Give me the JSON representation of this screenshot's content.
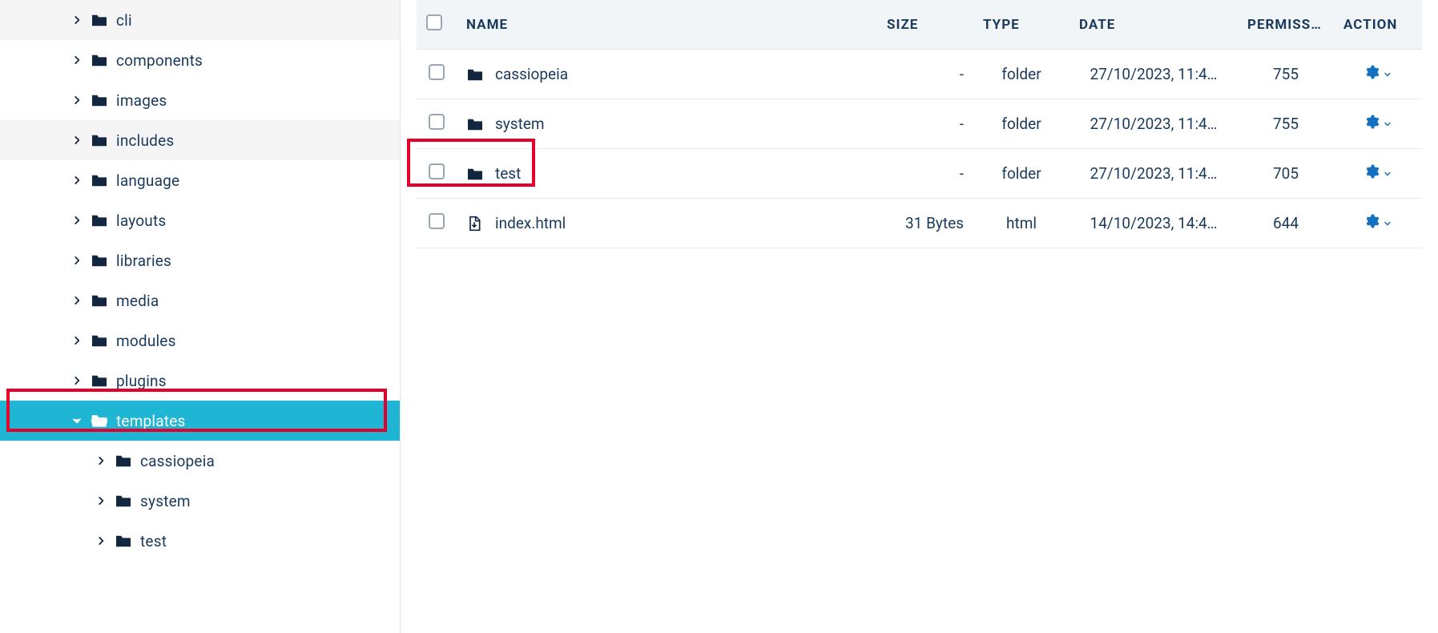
{
  "sidebar": {
    "items": [
      {
        "label": "cli",
        "level": 1,
        "expanded": false,
        "active": false
      },
      {
        "label": "components",
        "level": 1,
        "expanded": false,
        "active": false
      },
      {
        "label": "images",
        "level": 1,
        "expanded": false,
        "active": false
      },
      {
        "label": "includes",
        "level": 1,
        "expanded": false,
        "active": false,
        "hovered": true
      },
      {
        "label": "language",
        "level": 1,
        "expanded": false,
        "active": false
      },
      {
        "label": "layouts",
        "level": 1,
        "expanded": false,
        "active": false
      },
      {
        "label": "libraries",
        "level": 1,
        "expanded": false,
        "active": false
      },
      {
        "label": "media",
        "level": 1,
        "expanded": false,
        "active": false
      },
      {
        "label": "modules",
        "level": 1,
        "expanded": false,
        "active": false
      },
      {
        "label": "plugins",
        "level": 1,
        "expanded": false,
        "active": false
      },
      {
        "label": "templates",
        "level": 1,
        "expanded": true,
        "active": true,
        "highlight": true
      },
      {
        "label": "cassiopeia",
        "level": 2,
        "expanded": false,
        "active": false
      },
      {
        "label": "system",
        "level": 2,
        "expanded": false,
        "active": false
      },
      {
        "label": "test",
        "level": 2,
        "expanded": false,
        "active": false
      }
    ]
  },
  "table": {
    "headers": {
      "name": "NAME",
      "size": "SIZE",
      "type": "TYPE",
      "date": "DATE",
      "permissions": "PERMISS…",
      "action": "ACTION"
    },
    "rows": [
      {
        "name": "cassiopeia",
        "icon": "folder",
        "size": "-",
        "type": "folder",
        "date": "27/10/2023, 11:4…",
        "permissions": "755",
        "highlight": false
      },
      {
        "name": "system",
        "icon": "folder",
        "size": "-",
        "type": "folder",
        "date": "27/10/2023, 11:4…",
        "permissions": "755",
        "highlight": false
      },
      {
        "name": "test",
        "icon": "folder",
        "size": "-",
        "type": "folder",
        "date": "27/10/2023, 11:4…",
        "permissions": "705",
        "highlight": true
      },
      {
        "name": "index.html",
        "icon": "file",
        "size": "31 Bytes",
        "type": "html",
        "date": "14/10/2023, 14:4…",
        "permissions": "644",
        "highlight": false
      }
    ]
  },
  "colors": {
    "accent": "#1fb5d4",
    "highlight": "#e4002b",
    "darknavy": "#12273f",
    "gear": "#1670c0"
  }
}
